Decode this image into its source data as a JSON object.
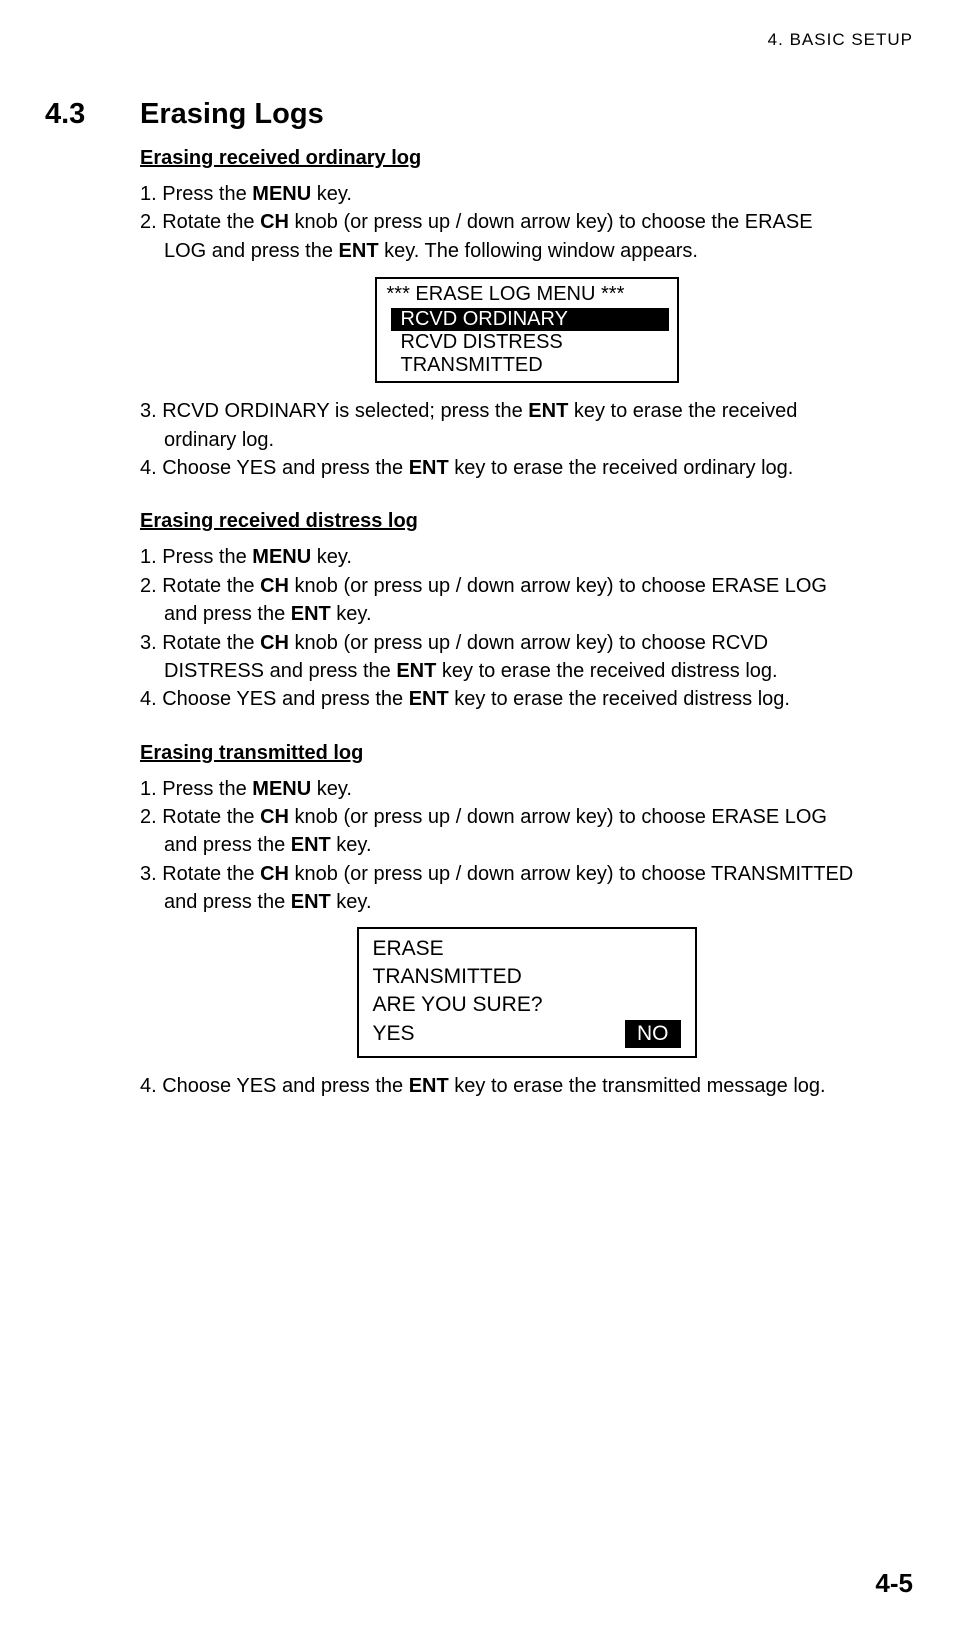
{
  "running_head": "4. BASIC SETUP",
  "section": {
    "num": "4.3",
    "title": "Erasing Logs"
  },
  "sub1": {
    "heading": "Erasing received ordinary log",
    "s1_a": "1. Press the ",
    "s1_b": "MENU",
    "s1_c": " key.",
    "s2_a": "2. Rotate the ",
    "s2_b": "CH",
    "s2_c": " knob (or press up / down arrow key) to choose the ERASE",
    "s2_d": "LOG and press the ",
    "s2_e": "ENT",
    "s2_f": " key. The following window appears.",
    "menu": {
      "title": "*** ERASE LOG MENU ***",
      "item1": "RCVD ORDINARY",
      "item2": "RCVD DISTRESS",
      "item3": "TRANSMITTED"
    },
    "s3_a": "3. RCVD ORDINARY is selected; press the ",
    "s3_b": "ENT",
    "s3_c": " key to erase the received",
    "s3_d": "ordinary log.",
    "s4_a": "4. Choose YES and press the ",
    "s4_b": "ENT",
    "s4_c": " key to erase the received ordinary log."
  },
  "sub2": {
    "heading": "Erasing received distress log",
    "s1_a": "1. Press the ",
    "s1_b": "MENU",
    "s1_c": " key.",
    "s2_a": "2. Rotate the ",
    "s2_b": "CH",
    "s2_c": " knob (or press up / down arrow key) to choose ERASE LOG",
    "s2_d": " and press the ",
    "s2_e": "ENT",
    "s2_f": " key.",
    "s3_a": "3. Rotate the ",
    "s3_b": "CH",
    "s3_c": " knob (or press up / down arrow key) to choose RCVD",
    "s3_d": "DISTRESS and press the ",
    "s3_e": "ENT",
    "s3_f": " key to erase the received distress log.",
    "s4_a": "4. Choose YES and press the ",
    "s4_b": "ENT",
    "s4_c": " key to erase the received distress log."
  },
  "sub3": {
    "heading": "Erasing transmitted log",
    "s1_a": "1. Press the ",
    "s1_b": "MENU",
    "s1_c": " key.",
    "s2_a": "2. Rotate the ",
    "s2_b": "CH",
    "s2_c": " knob (or press up / down arrow key) to choose ERASE LOG",
    "s2_d": " and press the ",
    "s2_e": "ENT",
    "s2_f": " key.",
    "s3_a": "3. Rotate the ",
    "s3_b": "CH",
    "s3_c": " knob (or press up / down arrow key) to choose TRANSMITTED",
    "s3_d": "and press the ",
    "s3_e": "ENT",
    "s3_f": " key.",
    "confirm": {
      "l1": "ERASE",
      "l2": "TRANSMITTED",
      "l3": "ARE YOU SURE?",
      "yes": "YES",
      "no": "NO"
    },
    "s4_a": "4. Choose YES and press the ",
    "s4_b": "ENT",
    "s4_c": " key to erase the transmitted message log."
  },
  "page_number": "4-5"
}
